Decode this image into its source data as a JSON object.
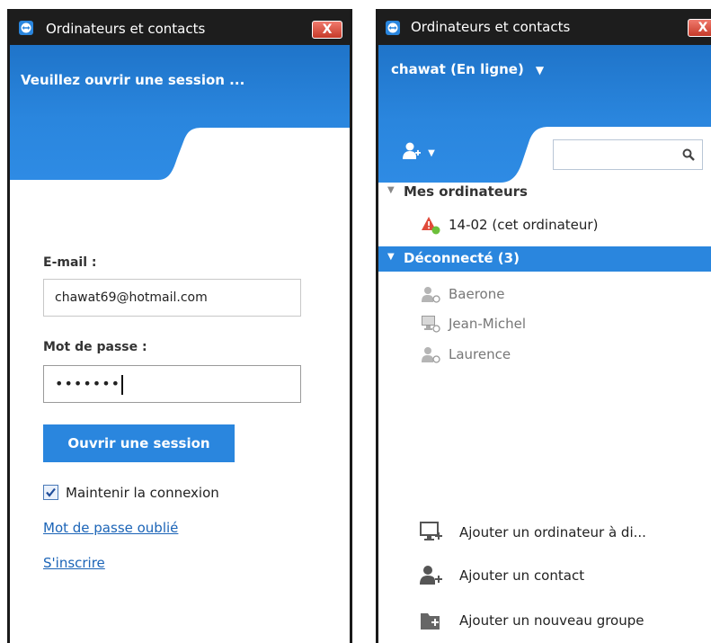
{
  "colors": {
    "accent": "#2a86de",
    "titlebar": "#1d1d1d",
    "close_button": "#d84a3a",
    "link": "#1b64b7",
    "online_status": "#6cbf3a"
  },
  "login_window": {
    "title": "Ordinateurs et contacts",
    "close_label": "X",
    "header": "Veuillez ouvrir une session ...",
    "email_label": "E-mail :",
    "email_value": "chawat69@hotmail.com",
    "password_label": "Mot de passe :",
    "password_value": "•••••••",
    "login_button": "Ouvrir une session",
    "remember_label": "Maintenir la connexion",
    "remember_checked": true,
    "forgot_link": "Mot de passe oublié",
    "signup_link": "S'inscrire"
  },
  "contacts_window": {
    "title": "Ordinateurs et contacts",
    "close_label": "X",
    "status": "chawat (En ligne)",
    "search_value": "",
    "groups": [
      {
        "label": "Mes ordinateurs",
        "expanded": true,
        "items": [
          {
            "label": "14-02 (cet ordinateur)",
            "icon": "warning-computer-icon"
          }
        ]
      },
      {
        "label": "Déconnecté (3)",
        "expanded": true,
        "items": [
          {
            "label": "Baerone",
            "icon": "contact-offline-icon"
          },
          {
            "label": "Jean-Michel",
            "icon": "computer-offline-icon"
          },
          {
            "label": "Laurence",
            "icon": "contact-offline-icon"
          }
        ]
      }
    ],
    "actions": [
      {
        "label": "Ajouter un ordinateur à di...",
        "icon": "add-computer-icon"
      },
      {
        "label": "Ajouter un contact",
        "icon": "add-contact-icon"
      },
      {
        "label": "Ajouter un nouveau groupe",
        "icon": "add-group-icon"
      }
    ]
  }
}
